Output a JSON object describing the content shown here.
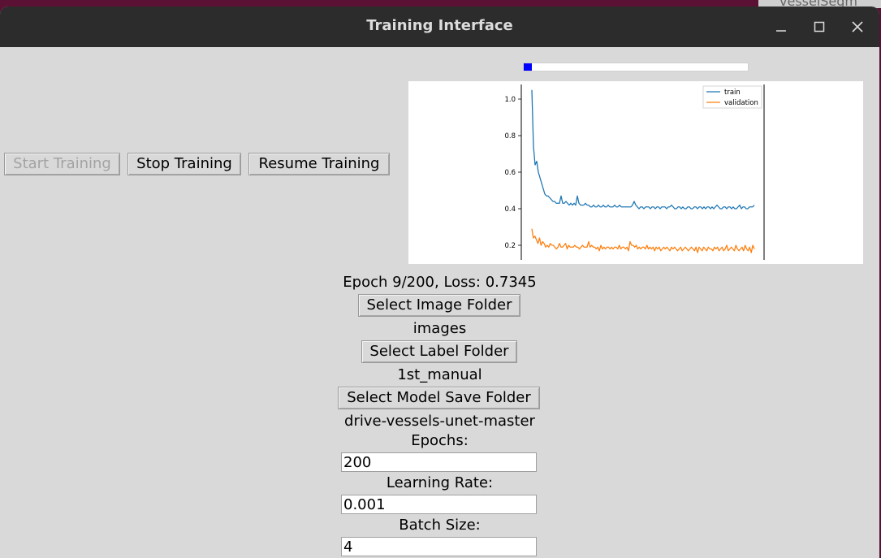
{
  "background_tab": {
    "label": "vesselSegm"
  },
  "window": {
    "title": "Training Interface"
  },
  "controls": {
    "start_label": "Start Training",
    "stop_label": "Stop Training",
    "resume_label": "Resume Training"
  },
  "progress": {
    "fraction": 0.036,
    "color": "#0000ff"
  },
  "status": {
    "text": "Epoch 9/200, Loss: 0.7345"
  },
  "folders": {
    "image_button": "Select Image Folder",
    "image_value": "images",
    "label_button": "Select Label Folder",
    "label_value": "1st_manual",
    "model_button": "Select Model Save Folder",
    "model_value": "drive-vessels-unet-master"
  },
  "params": {
    "epochs_label": "Epochs:",
    "epochs_value": "200",
    "lr_label": "Learning Rate:",
    "lr_value": "0.001",
    "batch_label": "Batch Size:",
    "batch_value": "4"
  },
  "chart_data": {
    "type": "line",
    "title": "",
    "xlabel": "",
    "ylabel": "",
    "xlim": [
      0,
      200
    ],
    "ylim": [
      0.12,
      1.08
    ],
    "yticks": [
      "0.2",
      "0.4",
      "0.6",
      "0.8",
      "1.0"
    ],
    "legend_position": "top-right",
    "series": [
      {
        "name": "train",
        "color": "#1f77b4",
        "values": [
          1.05,
          0.74,
          0.64,
          0.66,
          0.6,
          0.57,
          0.54,
          0.51,
          0.48,
          0.47,
          0.47,
          0.46,
          0.45,
          0.44,
          0.44,
          0.43,
          0.43,
          0.43,
          0.47,
          0.43,
          0.43,
          0.44,
          0.43,
          0.42,
          0.43,
          0.42,
          0.43,
          0.42,
          0.47,
          0.43,
          0.42,
          0.42,
          0.42,
          0.43,
          0.42,
          0.42,
          0.41,
          0.41,
          0.42,
          0.41,
          0.41,
          0.42,
          0.41,
          0.41,
          0.42,
          0.41,
          0.41,
          0.42,
          0.41,
          0.41,
          0.41,
          0.42,
          0.41,
          0.41,
          0.42,
          0.41,
          0.41,
          0.41,
          0.41,
          0.41,
          0.41,
          0.41,
          0.42,
          0.44,
          0.42,
          0.41,
          0.4,
          0.41,
          0.41,
          0.4,
          0.41,
          0.41,
          0.41,
          0.4,
          0.41,
          0.41,
          0.4,
          0.41,
          0.41,
          0.4,
          0.41,
          0.41,
          0.41,
          0.4,
          0.41,
          0.41,
          0.42,
          0.41,
          0.4,
          0.4,
          0.41,
          0.41,
          0.4,
          0.41,
          0.4,
          0.4,
          0.41,
          0.41,
          0.4,
          0.4,
          0.41,
          0.41,
          0.4,
          0.41,
          0.41,
          0.4,
          0.41,
          0.4,
          0.41,
          0.41,
          0.4,
          0.41,
          0.4,
          0.41,
          0.42,
          0.41,
          0.4,
          0.4,
          0.41,
          0.41,
          0.4,
          0.41,
          0.41,
          0.4,
          0.41,
          0.4,
          0.4,
          0.41,
          0.42,
          0.4,
          0.41,
          0.41,
          0.4,
          0.4,
          0.41,
          0.41,
          0.41,
          0.42
        ]
      },
      {
        "name": "validation",
        "color": "#ff7f0e",
        "values": [
          0.29,
          0.24,
          0.25,
          0.23,
          0.21,
          0.24,
          0.2,
          0.22,
          0.21,
          0.19,
          0.2,
          0.19,
          0.21,
          0.2,
          0.2,
          0.19,
          0.18,
          0.19,
          0.21,
          0.19,
          0.19,
          0.2,
          0.21,
          0.18,
          0.2,
          0.19,
          0.19,
          0.19,
          0.2,
          0.19,
          0.19,
          0.18,
          0.19,
          0.2,
          0.19,
          0.19,
          0.19,
          0.22,
          0.19,
          0.2,
          0.19,
          0.19,
          0.18,
          0.19,
          0.17,
          0.2,
          0.18,
          0.19,
          0.18,
          0.19,
          0.19,
          0.18,
          0.19,
          0.18,
          0.19,
          0.19,
          0.18,
          0.2,
          0.18,
          0.19,
          0.19,
          0.18,
          0.19,
          0.17,
          0.22,
          0.2,
          0.2,
          0.19,
          0.2,
          0.18,
          0.19,
          0.18,
          0.19,
          0.19,
          0.18,
          0.2,
          0.18,
          0.19,
          0.18,
          0.19,
          0.17,
          0.19,
          0.18,
          0.19,
          0.17,
          0.18,
          0.19,
          0.18,
          0.19,
          0.18,
          0.17,
          0.19,
          0.18,
          0.19,
          0.18,
          0.17,
          0.18,
          0.19,
          0.17,
          0.18,
          0.19,
          0.18,
          0.17,
          0.18,
          0.19,
          0.18,
          0.17,
          0.19,
          0.16,
          0.19,
          0.18,
          0.17,
          0.19,
          0.18,
          0.17,
          0.19,
          0.18,
          0.18,
          0.17,
          0.19,
          0.18,
          0.19,
          0.17,
          0.18,
          0.19,
          0.17,
          0.18,
          0.2,
          0.17,
          0.18,
          0.19,
          0.18,
          0.17,
          0.2,
          0.18,
          0.17,
          0.18,
          0.19,
          0.17,
          0.2,
          0.18,
          0.17,
          0.19,
          0.16,
          0.2,
          0.18
        ]
      }
    ]
  }
}
